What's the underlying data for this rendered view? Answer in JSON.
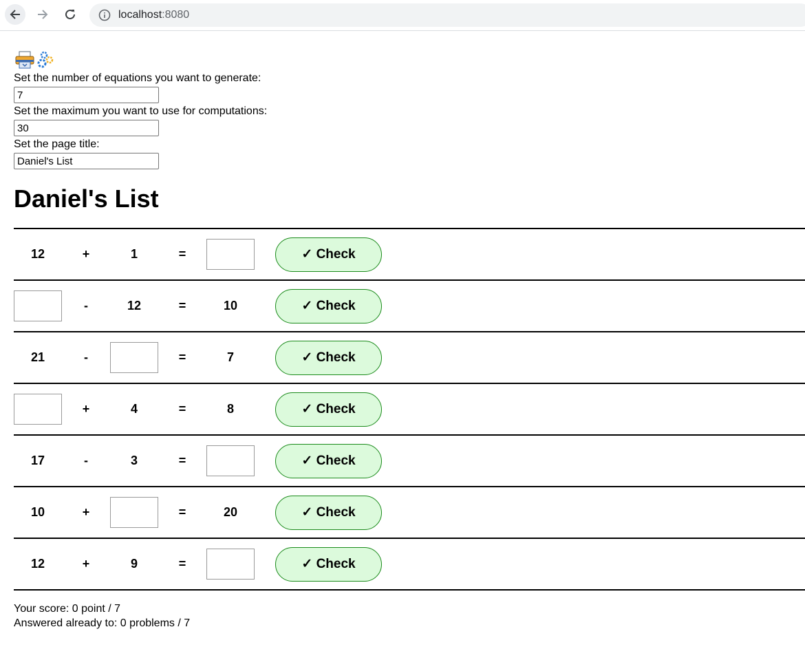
{
  "browser": {
    "url_host": "localhost",
    "url_port": ":8080"
  },
  "toolbar": {
    "icons": [
      "printer-icon",
      "gears-icon"
    ]
  },
  "settings": {
    "count_label": "Set the number of equations you want to generate:",
    "count_value": "7",
    "max_label": "Set the maximum you want to use for computations:",
    "max_value": "30",
    "title_label": "Set the page title:",
    "title_value": "Daniel's List"
  },
  "page_title": "Daniel's List",
  "equations": [
    {
      "cells": [
        "12",
        "+",
        "1",
        "=",
        ""
      ],
      "blank": 4
    },
    {
      "cells": [
        "",
        "-",
        "12",
        "=",
        "10"
      ],
      "blank": 0
    },
    {
      "cells": [
        "21",
        "-",
        "",
        "=",
        "7"
      ],
      "blank": 2
    },
    {
      "cells": [
        "",
        "+",
        "4",
        "=",
        "8"
      ],
      "blank": 0
    },
    {
      "cells": [
        "17",
        "-",
        "3",
        "=",
        ""
      ],
      "blank": 4
    },
    {
      "cells": [
        "10",
        "+",
        "",
        "=",
        "20"
      ],
      "blank": 2
    },
    {
      "cells": [
        "12",
        "+",
        "9",
        "=",
        ""
      ],
      "blank": 4
    }
  ],
  "check_label": "✓ Check",
  "colors": {
    "check_bg": "#dcfadc",
    "check_border": "#1a8a1a"
  },
  "score": {
    "score_text": "Your score: 0 point / 7",
    "answered_text": "Answered already to: 0 problems / 7"
  }
}
